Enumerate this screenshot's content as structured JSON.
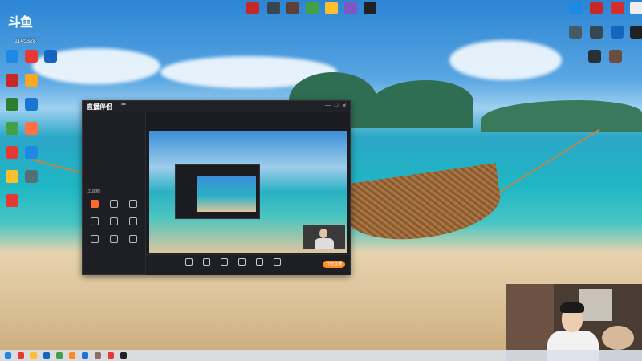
{
  "desktop": {
    "widget": {
      "brand": "斗鱼",
      "number": "1145328"
    },
    "icons_left": [
      {
        "label": "",
        "color": "#1e88e5"
      },
      {
        "label": "",
        "color": "#e53935"
      },
      {
        "label": "",
        "color": "#1565c0"
      },
      {
        "label": "",
        "color": "#c62828"
      },
      {
        "label": "",
        "color": "#f9a825"
      },
      {
        "label": "",
        "color": "#2e7d32"
      },
      {
        "label": "",
        "color": "#1976d2"
      },
      {
        "label": "",
        "color": "#43a047"
      },
      {
        "label": "",
        "color": "#ff7043"
      },
      {
        "label": "",
        "color": "#e53935"
      },
      {
        "label": "",
        "color": "#1e88e5"
      },
      {
        "label": "",
        "color": "#fbc02d"
      },
      {
        "label": "",
        "color": "#546e7a"
      },
      {
        "label": "",
        "color": "#e53935"
      }
    ],
    "icons_top": [
      {
        "label": "",
        "color": "#c62828"
      },
      {
        "label": "",
        "color": "#37474f"
      },
      {
        "label": "",
        "color": "#5d4037"
      },
      {
        "label": "",
        "color": "#43a047"
      },
      {
        "label": "",
        "color": "#fbc02d"
      },
      {
        "label": "",
        "color": "#7e57c2"
      },
      {
        "label": "",
        "color": "#212121"
      }
    ],
    "icons_right": [
      {
        "label": "",
        "color": "#1e88e5"
      },
      {
        "label": "",
        "color": "#c62828"
      },
      {
        "label": "",
        "color": "#d32f2f"
      },
      {
        "label": "",
        "color": "#eeeeee"
      },
      {
        "label": "",
        "color": "#455a64"
      },
      {
        "label": "",
        "color": "#37474f"
      },
      {
        "label": "",
        "color": "#1565c0"
      },
      {
        "label": "",
        "color": "#212121"
      },
      {
        "label": "",
        "color": "#263238"
      },
      {
        "label": "",
        "color": "#6d4c41"
      }
    ],
    "colors": {
      "accent": "#ff8a1f"
    }
  },
  "app": {
    "title": "直播伴侣",
    "badge": "",
    "window_controls": [
      "—",
      "□",
      "✕"
    ],
    "sidebar": {
      "tabs": [
        "",
        "",
        ""
      ],
      "scenes": [
        "",
        "",
        "",
        ""
      ],
      "tools_header": "工具箱",
      "tools": [
        "",
        "",
        "",
        "",
        "",
        "",
        "",
        "",
        ""
      ],
      "footer": ""
    },
    "scene_title": "",
    "bottom_buttons": [
      "",
      "",
      "",
      "",
      "",
      ""
    ],
    "start_live": "开始直播"
  }
}
